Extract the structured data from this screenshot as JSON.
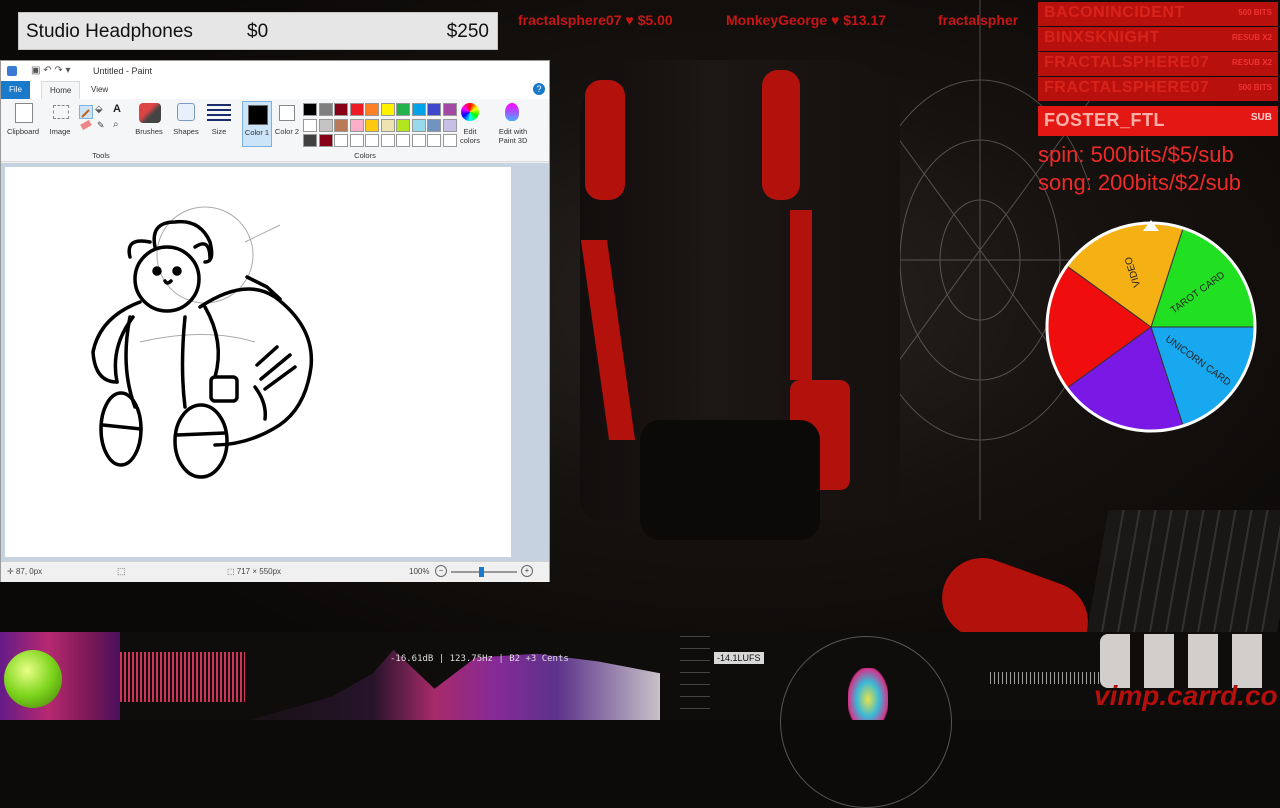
{
  "goal": {
    "item": "Studio Headphones",
    "current": "$0",
    "target": "$250"
  },
  "ticker": [
    {
      "name": "fractalsphere07",
      "amount": "$5.00"
    },
    {
      "name": "MonkeyGeorge",
      "amount": "$13.17"
    },
    {
      "name": "fractalspher",
      "amount": ""
    }
  ],
  "paint": {
    "title": "Untitled - Paint",
    "tabs": [
      "File",
      "Home",
      "View"
    ],
    "ribbon": {
      "clipboard": "Clipboard",
      "image": "Image",
      "tools": "Tools",
      "brushes": "Brushes",
      "shapes": "Shapes",
      "size": "Size",
      "color1": "Color 1",
      "color2": "Color 2",
      "colors": "Colors",
      "edit_colors": "Edit colors",
      "edit_3d": "Edit with Paint 3D"
    },
    "status": {
      "cursor": "87, 0px",
      "size": "717 × 550px",
      "zoom": "100%"
    }
  },
  "recent_events": [
    {
      "name": "BACONINCIDENT",
      "amount": "500 BITS"
    },
    {
      "name": "BINXSKNIGHT",
      "amount": "RESUB X2"
    },
    {
      "name": "FRACTALSPHERE07",
      "amount": "RESUB X2"
    },
    {
      "name": "FRACTALSPHERE07",
      "amount": "500 BITS"
    },
    {
      "name": "FOSTER_FTL",
      "amount": "SUB"
    }
  ],
  "spin_text": "spin: 500bits/$5/sub",
  "song_text": "song: 200bits/$2/sub",
  "wheel": {
    "slices": [
      {
        "label": "TAROT CARD",
        "color": "#21e021"
      },
      {
        "label": "UNICORN CARD",
        "color": "#17a8ef"
      },
      {
        "label": "",
        "color": "#7a18e6"
      },
      {
        "label": "",
        "color": "#f00d0d"
      },
      {
        "label": "VIDEO",
        "color": "#f5b014"
      }
    ]
  },
  "visualizer": {
    "readout": "-16.61dB | 123.75Hz | B2 +3 Cents",
    "lufs": "-14.1LUFS"
  },
  "url": "vimp.carrd.co"
}
